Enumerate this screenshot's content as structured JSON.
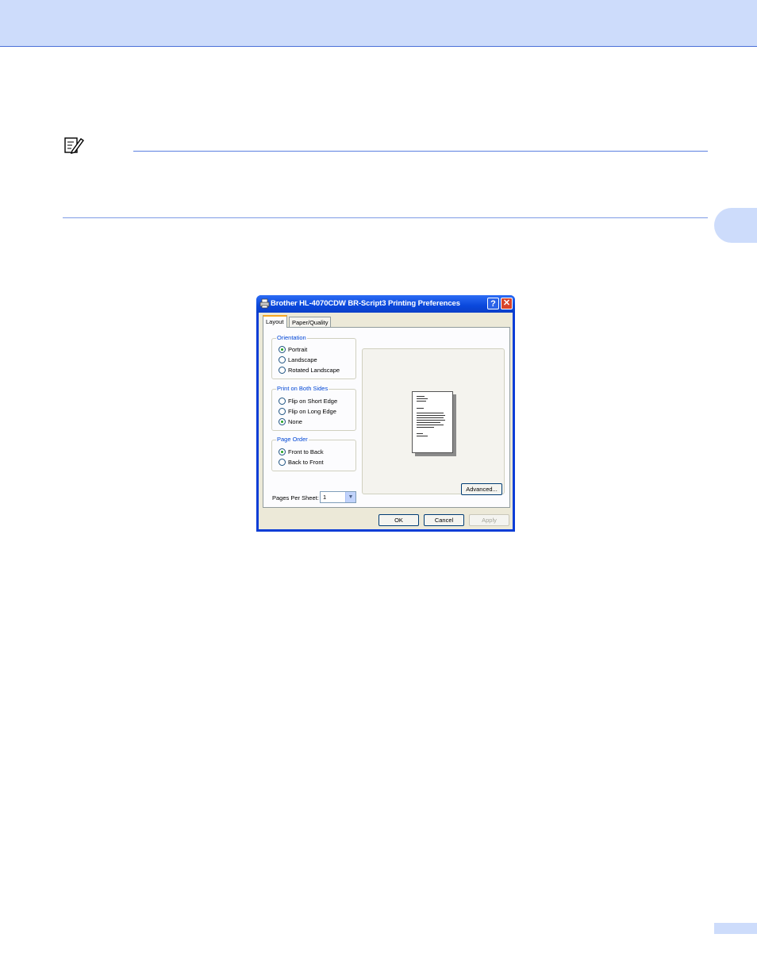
{
  "dialog": {
    "title": "Brother HL-4070CDW BR-Script3 Printing Preferences",
    "help_glyph": "?",
    "close_glyph": "✕",
    "tabs": [
      {
        "label": "Layout",
        "active": true
      },
      {
        "label": "Paper/Quality",
        "active": false
      }
    ],
    "orientation": {
      "title": "Orientation",
      "options": [
        {
          "label": "Portrait",
          "checked": true
        },
        {
          "label": "Landscape",
          "checked": false
        },
        {
          "label": "Rotated Landscape",
          "checked": false
        }
      ]
    },
    "both_sides": {
      "title": "Print on Both Sides",
      "options": [
        {
          "label": "Flip on Short Edge",
          "checked": false
        },
        {
          "label": "Flip on Long Edge",
          "checked": false
        },
        {
          "label": "None",
          "checked": true
        }
      ]
    },
    "page_order": {
      "title": "Page Order",
      "options": [
        {
          "label": "Front to Back",
          "checked": true
        },
        {
          "label": "Back to Front",
          "checked": false
        }
      ]
    },
    "pages_per_sheet": {
      "label": "Pages Per Sheet:",
      "value": "1"
    },
    "buttons": {
      "advanced": "Advanced...",
      "ok": "OK",
      "cancel": "Cancel",
      "apply": "Apply"
    }
  },
  "icons": {
    "note": "note-pencil-icon",
    "printer": "printer-icon"
  },
  "colors": {
    "header_band": "#cddcfb",
    "title_bar": "#0a48dc",
    "group_title": "#0046d5"
  }
}
